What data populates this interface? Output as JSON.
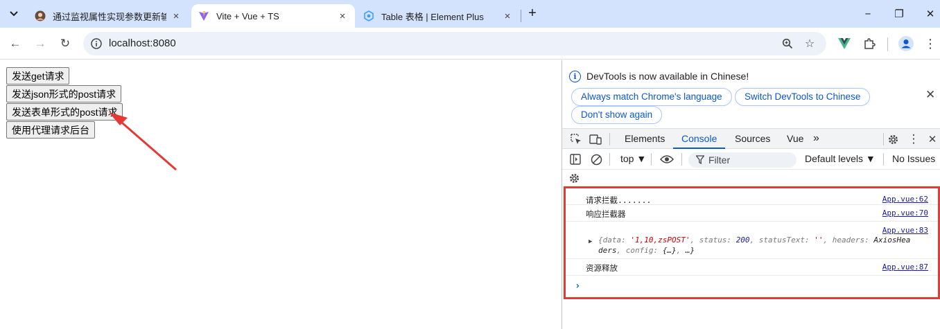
{
  "browser": {
    "tabs": [
      {
        "title": "通过监视属性实现参数更新输出",
        "icon": "avatar-favicon-icon",
        "active": false
      },
      {
        "title": "Vite + Vue + TS",
        "icon": "vite-logo-icon",
        "active": true
      },
      {
        "title": "Table 表格 | Element Plus",
        "icon": "element-plus-logo-icon",
        "active": false
      }
    ],
    "tab_close_glyph": "×",
    "new_tab_glyph": "+",
    "window_controls": {
      "minimize": "−",
      "maximize": "❐",
      "close": "✕"
    },
    "nav": {
      "back": "←",
      "forward": "→",
      "reload": "↻"
    },
    "url": "localhost:8080",
    "omnibox_icons": {
      "zoom": "⚲",
      "bookmark": "☆"
    },
    "toolbar_icons": {
      "vue_devtools": "vue-devtools-icon",
      "extensions": "puzzle-icon",
      "profile": "profile-icon",
      "menu": "⋮"
    }
  },
  "page": {
    "buttons": [
      {
        "label": "发送get请求"
      },
      {
        "label": "发送json形式的post请求"
      },
      {
        "label": "发送表单形式的post请求"
      },
      {
        "label": "使用代理请求后台"
      }
    ],
    "annotation_color": "#e53935"
  },
  "devtools": {
    "banner": {
      "message": "DevTools is now available in Chinese!",
      "buttons": [
        "Always match Chrome's language",
        "Switch DevTools to Chinese",
        "Don't show again"
      ],
      "close_glyph": "✕"
    },
    "tabs": [
      "Elements",
      "Console",
      "Sources",
      "Vue"
    ],
    "active_tab": "Console",
    "more_tabs_glyph": "»",
    "console_toolbar": {
      "context": "top ▼",
      "filter_placeholder": "Filter",
      "levels": "Default levels ▼",
      "issues": "No Issues"
    },
    "logs": [
      {
        "message": "请求拦截.......",
        "source": "App.vue:62"
      },
      {
        "message": "响应拦截器",
        "source": "App.vue:70"
      },
      {
        "message": "",
        "source": "App.vue:83",
        "object_line1": {
          "k_data": "{data: ",
          "v_data": "'1,10,zsPOST'",
          "k_status": ", status: ",
          "v_status": "200",
          "k_statusText": ", statusText: ",
          "v_statusText": "''",
          "k_headers": ", headers: ",
          "v_headers": "AxiosHea"
        },
        "object_line2": {
          "v_headers_tail": "ders",
          "k_config": ", config: ",
          "v_config": "{…}",
          "k_tail": ", ",
          "v_tail": "…}"
        }
      },
      {
        "message": "资源释放",
        "source": "App.vue:87"
      }
    ],
    "prompt": "›",
    "highlight_color": "#e53935",
    "accent": "#0b57d0"
  }
}
